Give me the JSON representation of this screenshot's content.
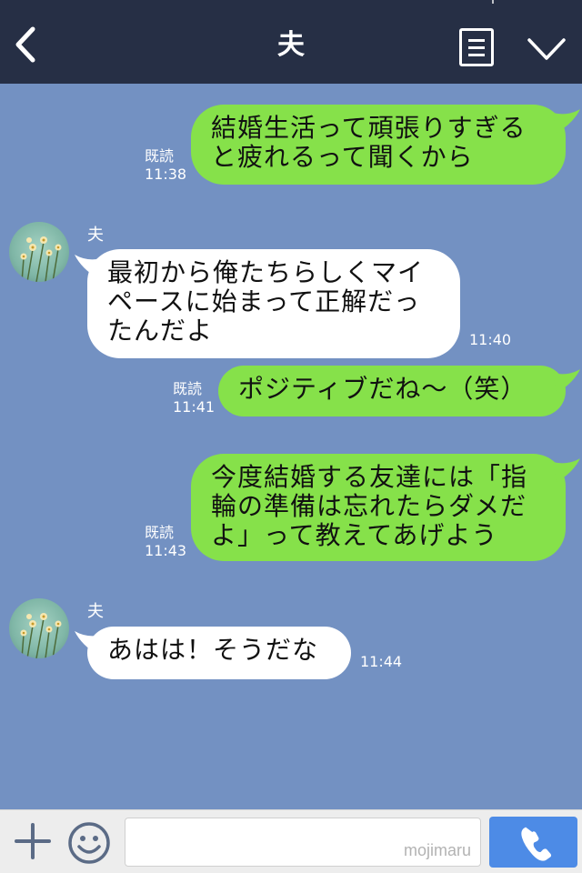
{
  "header": {
    "title": "夫",
    "back_icon": "chevron-left-icon",
    "menu_icon": "menu-list-icon",
    "more_icon": "chevron-down-icon",
    "bg_color": "#262f45"
  },
  "chat": {
    "bg_color": "#7391c2",
    "out_color": "#86e14a",
    "in_color": "#ffffff",
    "messages": [
      {
        "dir": "out",
        "text": "結婚生活って頑張りすぎる\nと疲れるって聞くから",
        "read": "既読",
        "time": "11:38"
      },
      {
        "dir": "in",
        "sender": "夫",
        "text": "最初から俺たちらしくマイ\nペースに始まって正解だっ\nたんだよ",
        "time": "11:40"
      },
      {
        "dir": "out",
        "text": "ポジティブだね〜（笑）",
        "read": "既読",
        "time": "11:41"
      },
      {
        "dir": "out",
        "text": "今度結婚する友達には「指\n輪の準備は忘れたらダメだ\nよ」って教えてあげよう",
        "read": "既読",
        "time": "11:43"
      },
      {
        "dir": "in",
        "sender": "夫",
        "text": "あはは！そうだな",
        "time": "11:44"
      }
    ]
  },
  "input_bar": {
    "plus_icon": "plus-icon",
    "emoji_icon": "emoji-smile-icon",
    "input_value": "",
    "watermark": "mojimaru",
    "call_icon": "phone-icon",
    "call_color": "#4d8be6"
  }
}
